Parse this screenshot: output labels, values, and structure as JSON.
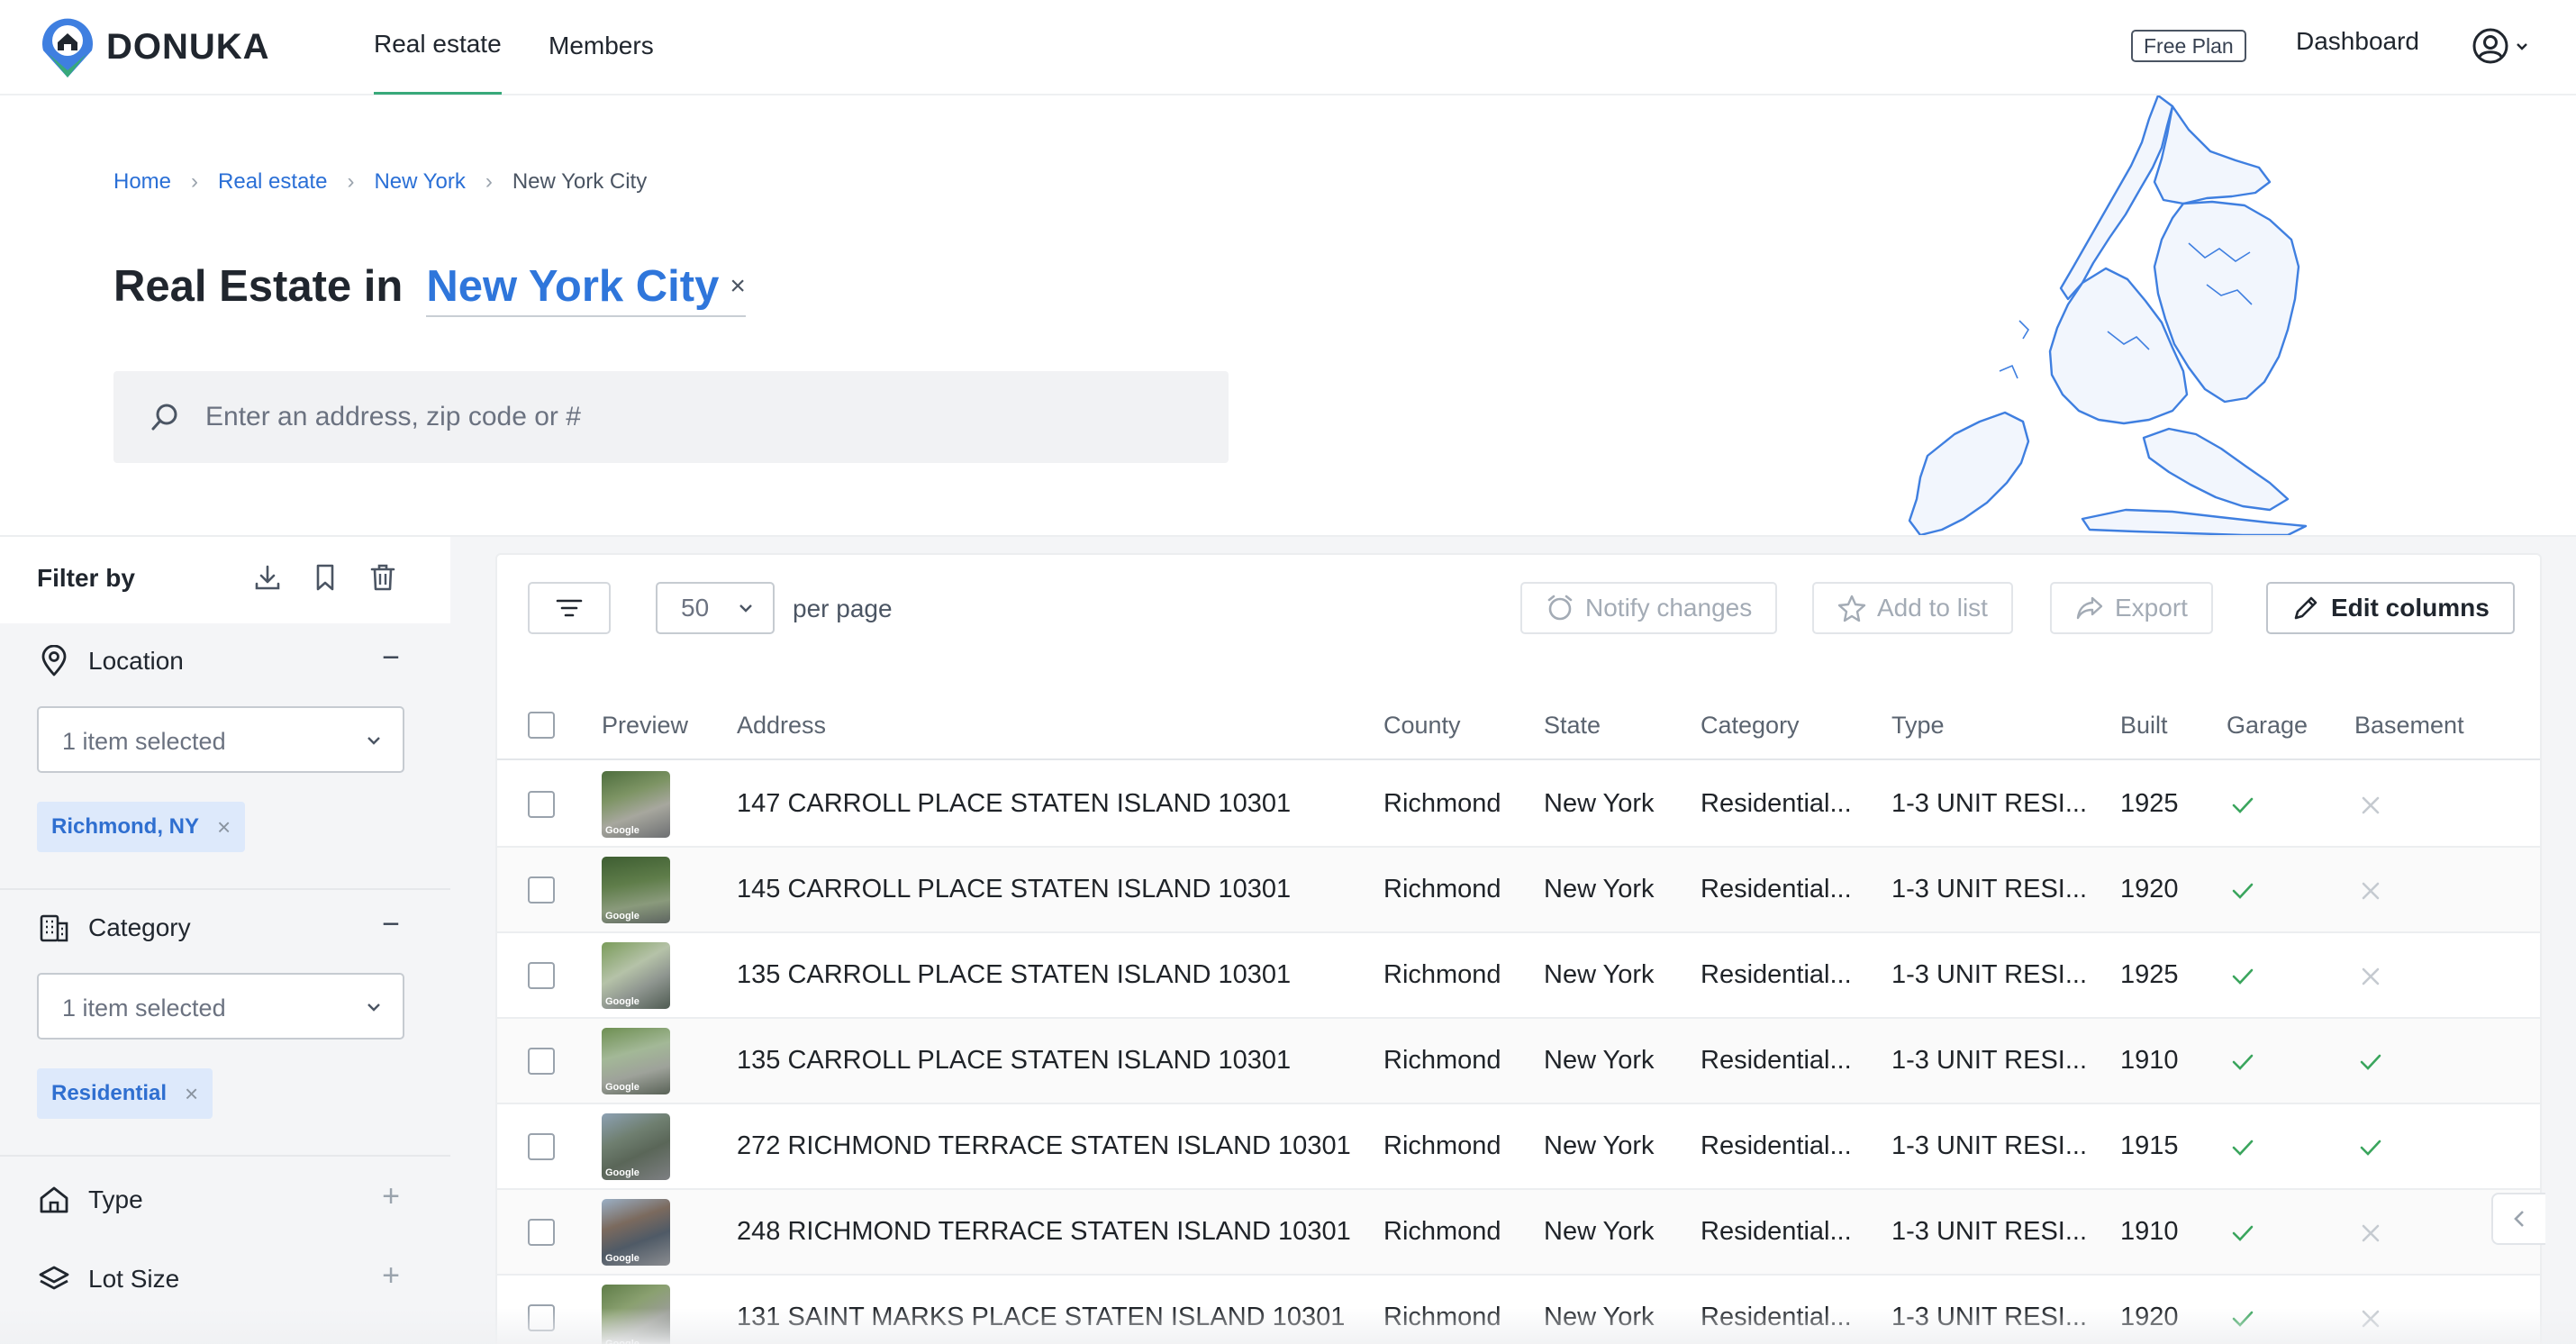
{
  "app": {
    "name": "DONUKA"
  },
  "nav": {
    "links": [
      "Real estate",
      "Members"
    ],
    "plan_badge": "Free Plan",
    "dashboard": "Dashboard"
  },
  "breadcrumb": {
    "items": [
      "Home",
      "Real estate",
      "New York"
    ],
    "current": "New York City",
    "separator": "›"
  },
  "headline": {
    "prefix": "Real Estate in",
    "city": "New York City",
    "clear": "×"
  },
  "search": {
    "placeholder": "Enter an address, zip code or #"
  },
  "filters": {
    "title": "Filter by",
    "sections": [
      {
        "label": "Location",
        "icon": "location-pin-icon",
        "expanded": true,
        "select_value": "1 item selected",
        "chip": "Richmond, NY"
      },
      {
        "label": "Category",
        "icon": "building-icon",
        "expanded": true,
        "select_value": "1 item selected",
        "chip": "Residential"
      },
      {
        "label": "Type",
        "icon": "home-icon",
        "expanded": false
      },
      {
        "label": "Lot Size",
        "icon": "layers-icon",
        "expanded": false
      }
    ],
    "toggle_expanded": "−",
    "toggle_collapsed": "+",
    "chip_remove": "×"
  },
  "toolbar": {
    "per_page_value": "50",
    "per_page_label": "per page",
    "notify": "Notify changes",
    "add_to_list": "Add to list",
    "export": "Export",
    "edit_columns": "Edit columns"
  },
  "table": {
    "columns": [
      "Preview",
      "Address",
      "County",
      "State",
      "Category",
      "Type",
      "Built",
      "Garage",
      "Basement"
    ],
    "thumb_watermark": "Google",
    "rows": [
      {
        "address": "147 CARROLL PLACE STATEN ISLAND 10301",
        "county": "Richmond",
        "state": "New York",
        "category": "Residential...",
        "type": "1-3 UNIT RESI...",
        "built": "1925",
        "garage": true,
        "basement": false
      },
      {
        "address": "145 CARROLL PLACE STATEN ISLAND 10301",
        "county": "Richmond",
        "state": "New York",
        "category": "Residential...",
        "type": "1-3 UNIT RESI...",
        "built": "1920",
        "garage": true,
        "basement": false
      },
      {
        "address": "135 CARROLL PLACE STATEN ISLAND 10301",
        "county": "Richmond",
        "state": "New York",
        "category": "Residential...",
        "type": "1-3 UNIT RESI...",
        "built": "1925",
        "garage": true,
        "basement": false
      },
      {
        "address": "135 CARROLL PLACE STATEN ISLAND 10301",
        "county": "Richmond",
        "state": "New York",
        "category": "Residential...",
        "type": "1-3 UNIT RESI...",
        "built": "1910",
        "garage": true,
        "basement": true
      },
      {
        "address": "272 RICHMOND TERRACE STATEN ISLAND 10301",
        "county": "Richmond",
        "state": "New York",
        "category": "Residential...",
        "type": "1-3 UNIT RESI...",
        "built": "1915",
        "garage": true,
        "basement": true
      },
      {
        "address": "248 RICHMOND TERRACE STATEN ISLAND 10301",
        "county": "Richmond",
        "state": "New York",
        "category": "Residential...",
        "type": "1-3 UNIT RESI...",
        "built": "1910",
        "garage": true,
        "basement": false
      },
      {
        "address": "131 SAINT MARKS PLACE STATEN ISLAND 10301",
        "county": "Richmond",
        "state": "New York",
        "category": "Residential...",
        "type": "1-3 UNIT RESI...",
        "built": "1920",
        "garage": true,
        "basement": false
      }
    ]
  },
  "colors": {
    "accent_blue": "#2f76db",
    "accent_green": "#38a97a",
    "check_green": "#3aa55d",
    "cross_gray": "#c5cad0",
    "map_stroke": "#3f7fe0",
    "map_fill": "#f2f6fd"
  }
}
